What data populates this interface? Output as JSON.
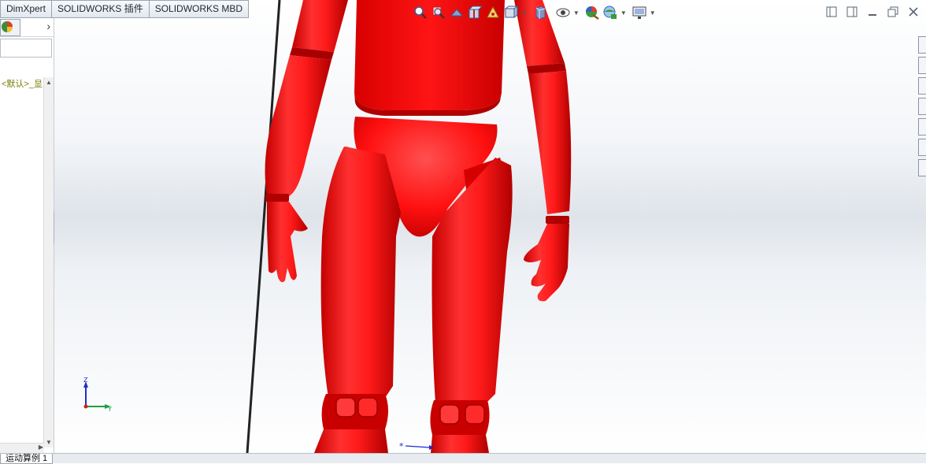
{
  "tabs": [
    {
      "label": "DimXpert"
    },
    {
      "label": "SOLIDWORKS 插件"
    },
    {
      "label": "SOLIDWORKS MBD"
    }
  ],
  "left_panel": {
    "config_text": "<默认>_显",
    "expand_arrow": "›"
  },
  "triad": {
    "x_label": "Y",
    "z_label": "Z"
  },
  "bottom_tab": {
    "label": "运动算例 1"
  },
  "colors": {
    "model": "#ff1010",
    "accent": "#3c5a99"
  },
  "icons": {
    "hud": [
      "zoom-to-fit-icon",
      "zoom-area-icon",
      "previous-view-icon",
      "section-view-icon",
      "dynamic-annotation-icon",
      "view-orientation-icon",
      "display-style-icon",
      "hide-show-icon",
      "edit-appearance-icon",
      "apply-scene-icon",
      "view-settings-icon"
    ],
    "window": [
      "tile-left-icon",
      "tile-right-icon",
      "minimize-icon",
      "restore-icon",
      "close-icon"
    ],
    "taskpane": [
      "home-icon",
      "parts-icon",
      "design-library-icon",
      "file-explorer-icon",
      "appearances-icon",
      "custom-properties-icon",
      "forum-icon"
    ]
  }
}
